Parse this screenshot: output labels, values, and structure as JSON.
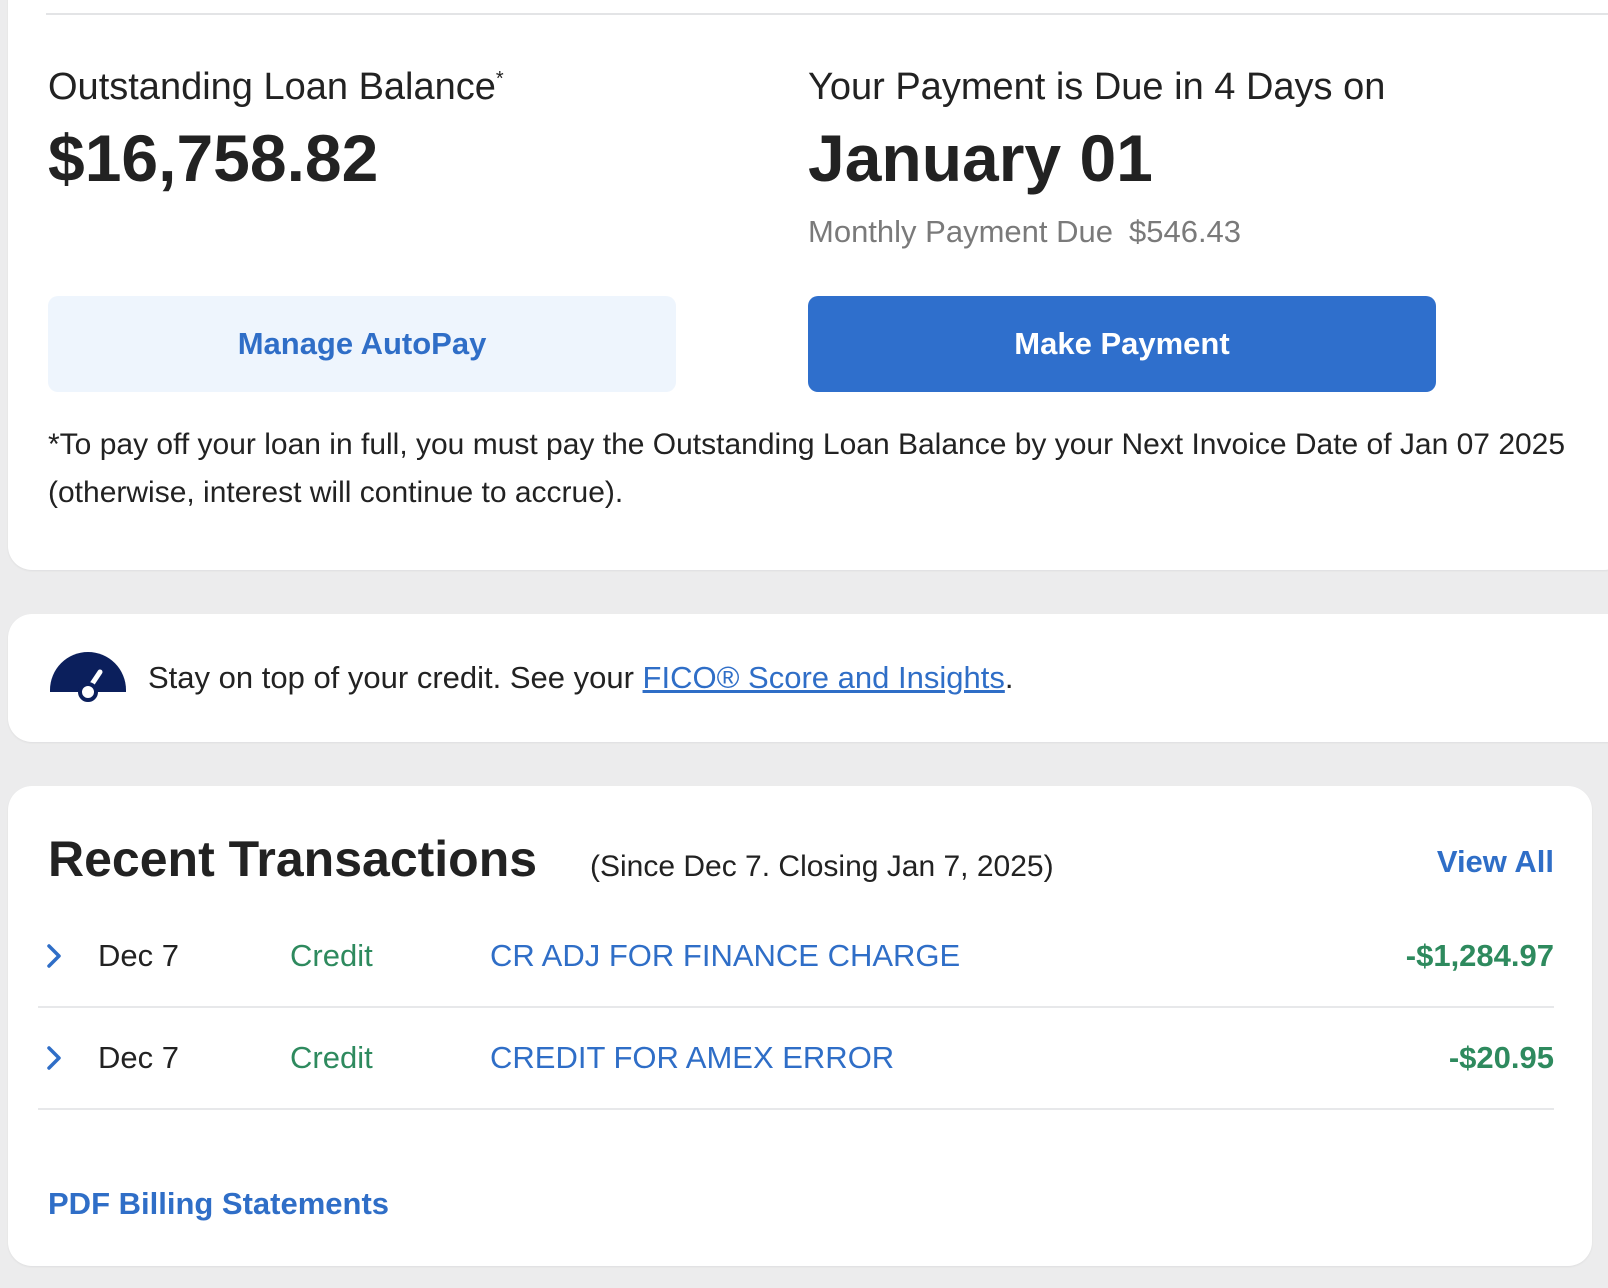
{
  "loan": {
    "balance_label": "Outstanding Loan Balance",
    "balance_asterisk": "*",
    "balance_amount": "$16,758.82",
    "due_label": "Your Payment is Due in 4 Days on",
    "due_date": "January 01",
    "monthly_label": "Monthly Payment Due",
    "monthly_amount": "$546.43",
    "autopay_label": "Manage AutoPay",
    "pay_label": "Make Payment",
    "footnote": "*To pay off your loan in full, you must pay the Outstanding Loan Balance by your Next Invoice Date of Jan 07 2025 (otherwise, interest will continue to accrue)."
  },
  "fico": {
    "icon": "credit-gauge-icon",
    "text": "Stay on top of your credit. See your ",
    "link": "FICO® Score and Insights",
    "suffix": "."
  },
  "transactions": {
    "title": "Recent Transactions",
    "subtitle": "(Since Dec 7. Closing Jan 7, 2025)",
    "view_all": "View All",
    "rows": [
      {
        "date": "Dec 7",
        "type": "Credit",
        "description": "CR ADJ FOR FINANCE CHARGE",
        "amount": "-$1,284.97"
      },
      {
        "date": "Dec 7",
        "type": "Credit",
        "description": "CREDIT FOR AMEX ERROR",
        "amount": "-$20.95"
      }
    ],
    "pdf_link": "PDF Billing Statements"
  },
  "colors": {
    "accent_blue": "#2f6fcc",
    "credit_green": "#2e8a5e",
    "gauge_navy": "#0b1f5c"
  }
}
